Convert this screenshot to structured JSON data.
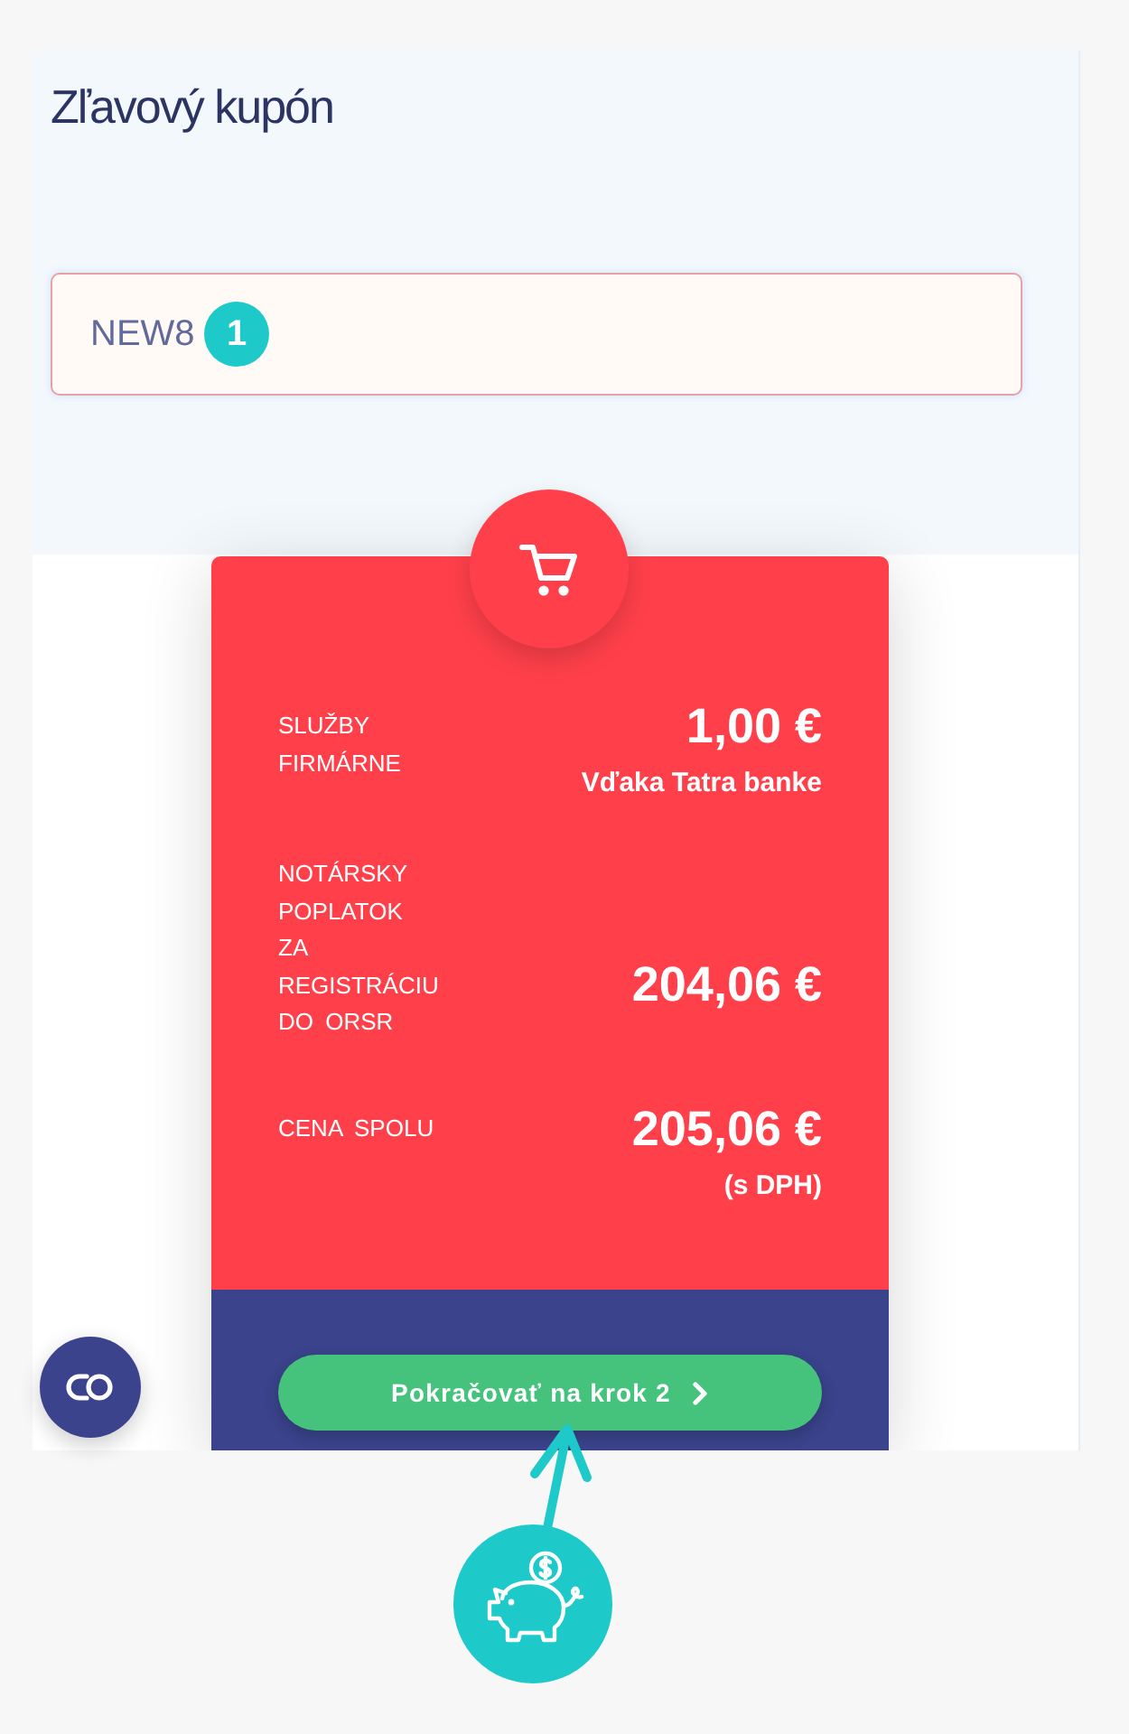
{
  "header": {
    "title": "Zľavový kupón"
  },
  "coupon": {
    "value": "NEW8",
    "marker": {
      "label": "1"
    }
  },
  "summary": {
    "items": [
      {
        "label": "SLUŽBY FIRMÁRNE",
        "amount": "1,00 €",
        "note": "Vďaka Tatra banke"
      },
      {
        "label": "NOTÁRSKY POPLATOK ZA REGISTRÁCIU DO ORSR",
        "amount": "204,06 €"
      },
      {
        "label": "CENA SPOLU",
        "amount": "205,06 €",
        "note": "(s DPH)"
      }
    ],
    "button": {
      "label": "Pokračovať na krok 2"
    }
  }
}
